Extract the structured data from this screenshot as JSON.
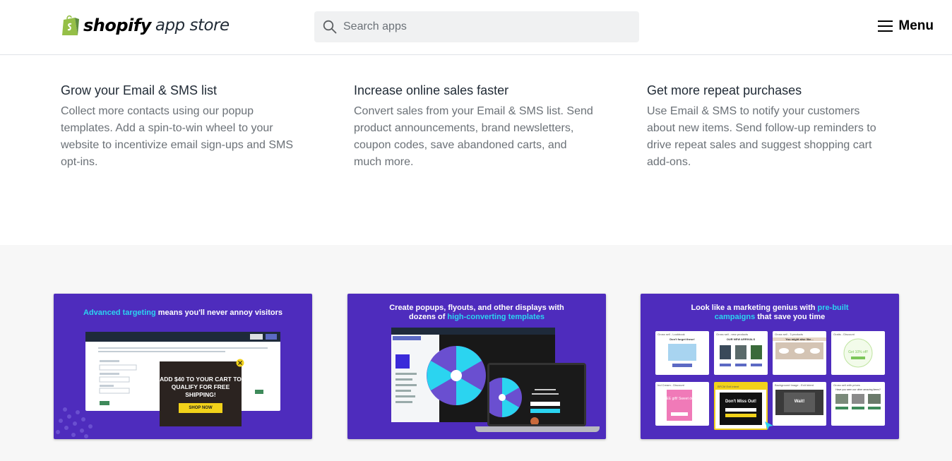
{
  "header": {
    "brand": "shopify",
    "store_label": "app store",
    "search_placeholder": "Search apps",
    "menu_label": "Menu"
  },
  "features": [
    {
      "title": "Grow your Email & SMS list",
      "body": "Collect more contacts using our popup templates. Add a spin-to-win wheel to your website to incentivize email sign-ups and SMS opt-ins."
    },
    {
      "title": "Increase online sales faster",
      "body": "Convert sales from your Email & SMS list. Send product announcements, brand newsletters, coupon codes, save abandoned carts, and much more."
    },
    {
      "title": "Get more repeat purchases",
      "body": "Use Email & SMS to notify your customers about new items. Send follow-up reminders to drive repeat sales and suggest shopping cart add-ons."
    }
  ],
  "cards": [
    {
      "title_highlight": "Advanced targeting",
      "title_rest": " means you'll never annoy visitors",
      "popup_text": "ADD $40 TO YOUR CART TO QUALIFY FOR FREE SHIPPING!",
      "popup_button": "SHOP NOW"
    },
    {
      "title_line1": "Create popups, flyouts, and other displays with",
      "title_line2_pre": "dozens of ",
      "title_line2_highlight": "high-converting templates"
    },
    {
      "title_line1_pre": "Look like a marketing genius with ",
      "title_line1_highlight": "pre-built",
      "title_line2_highlight": "campaigns",
      "title_line2_rest": " that save you time",
      "tiles": [
        {
          "label": "Gross sell - Lookbook",
          "center": "Don't forget these!"
        },
        {
          "label": "Gross sell - new products",
          "center": "OUR NEW ARRIVALS"
        },
        {
          "label": "Gross sell - 3 products",
          "center": "You might also like..."
        },
        {
          "label": "Gratis - Discount",
          "center": "Get 10% off!"
        },
        {
          "label": "Ind Cream - Discount",
          "center": "FREE gift! Sweet deal!"
        },
        {
          "label": "BFCM Exit Intent",
          "center": "Don't Miss Out!"
        },
        {
          "label": "Background Image - Exit Intent",
          "center": "Wait!"
        },
        {
          "label": "Gross sell with prices",
          "center": "Have you seen our other amazing items?"
        }
      ]
    }
  ],
  "colors": {
    "card_bg": "#4e2cbd",
    "highlight": "#2bd4f0",
    "shopify_green": "#95bf47"
  }
}
